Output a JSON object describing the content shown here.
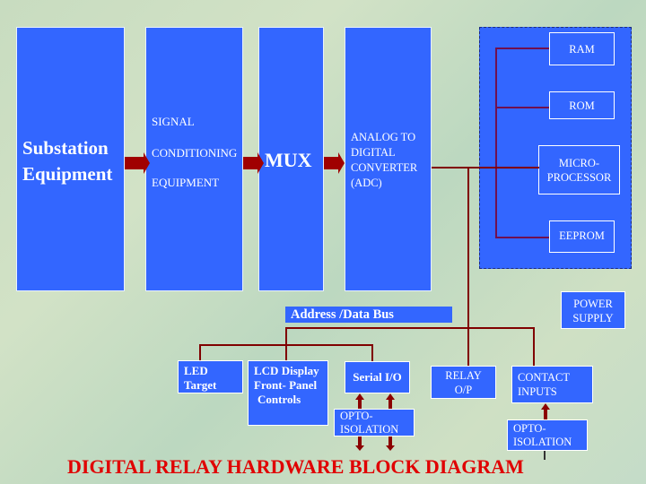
{
  "blocks": {
    "substation": {
      "line1": "Substation",
      "line2": "Equipment"
    },
    "signal": {
      "line1": "SIGNAL",
      "line2": "CONDITIONING",
      "line3": "EQUIPMENT"
    },
    "mux": {
      "label": "MUX"
    },
    "adc": {
      "line1": "ANALOG TO",
      "line2": "DIGITAL",
      "line3": "CONVERTER",
      "line4": "(ADC)"
    }
  },
  "processor_group": {
    "ram": "RAM",
    "rom": "ROM",
    "micro": {
      "line1": "MICRO-",
      "line2": "PROCESSOR"
    },
    "eeprom": "EEPROM"
  },
  "power_supply": {
    "line1": "POWER",
    "line2": "SUPPLY"
  },
  "bus": {
    "label": "Address /Data Bus"
  },
  "peripherals": {
    "led": {
      "line1": "LED",
      "line2": "Target"
    },
    "lcd": {
      "line1": "LCD Display",
      "line2": "Front- Panel",
      "line3": "Controls"
    },
    "serial": "Serial I/O",
    "relay": {
      "line1": "RELAY",
      "line2": "O/P"
    },
    "contact": {
      "line1": "CONTACT",
      "line2": "INPUTS"
    },
    "opto1": {
      "line1": "OPTO-",
      "line2": "ISOLATION"
    },
    "opto2": {
      "line1": "OPTO-",
      "line2": "ISOLATION"
    }
  },
  "title": "DIGITAL RELAY HARDWARE BLOCK DIAGRAM",
  "colors": {
    "block": "#3366ff",
    "arrow": "#a00000",
    "line": "#800000",
    "title": "#e00000"
  }
}
